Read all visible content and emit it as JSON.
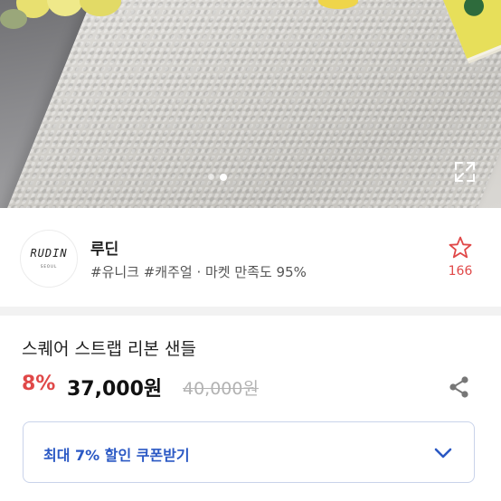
{
  "carousel": {
    "page_count": 2,
    "active_page": 2
  },
  "seller": {
    "logo_text": "RUDIN",
    "logo_subtext": "SEOUL",
    "name": "루딘",
    "meta": "#유니크 #캐주얼 · 마켓 만족도 95%",
    "favorite_count": "166"
  },
  "product": {
    "title": "스퀘어 스트랩 리본 샌들",
    "discount": "8%",
    "price": "37,000원",
    "original_price": "40,000원"
  },
  "coupon": {
    "label": "최대 7% 할인 쿠폰받기"
  },
  "colors": {
    "accent_red": "#e04848",
    "coupon_blue": "#2a58c4"
  },
  "icons": {
    "expand": "expand-icon",
    "favorite": "star-icon",
    "share": "share-icon",
    "dropdown": "chevron-down-icon"
  }
}
